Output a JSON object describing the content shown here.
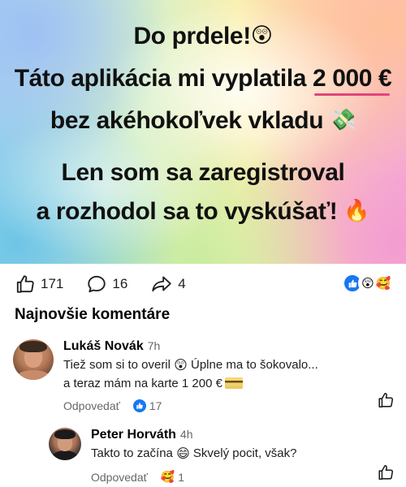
{
  "banner": {
    "line1_text": "Do prdele!",
    "line1_emoji": "😲",
    "line2_prefix": "Táto aplikácia mi vyplatila ",
    "line2_amount": "2 000 €",
    "line3_text": "bez akéhokoľvek vkladu",
    "line3_emoji": "💸",
    "line4_text": "Len som sa zaregistroval",
    "line5_text": "a rozhodol sa to vyskúšať!",
    "line5_emoji": "🔥"
  },
  "stats": {
    "likes": "171",
    "comments": "16",
    "shares": "4",
    "reaction_emojis": [
      "👍",
      "😲",
      "🥰"
    ]
  },
  "comments_section": {
    "title": "Najnovšie komentáre"
  },
  "comments": [
    {
      "name": "Lukáš Novák",
      "time": "7h",
      "text_part1": "Tiež som si to overil ",
      "emoji1": "😲",
      "text_part2": " Úplne ma to šokovalo...",
      "text_line2": "a teraz mám na karte 1 200 €",
      "reply_label": "Odpovedať",
      "reaction_count": "17"
    },
    {
      "name": "Peter Horváth",
      "time": "4h",
      "text_part1": "Takto to začína ",
      "emoji1": "😄",
      "text_part2": " Skvelý pocit, však?",
      "reply_label": "Odpovedať",
      "reaction_emoji": "🥰",
      "reaction_count": "1"
    }
  ],
  "colors": {
    "accent_underline": "#e0457b",
    "like_blue": "#1877f2",
    "meta_gray": "#65676b"
  },
  "icons": [
    "thumbs-up-icon",
    "comment-bubble-icon",
    "share-arrow-icon",
    "credit-card-icon"
  ]
}
